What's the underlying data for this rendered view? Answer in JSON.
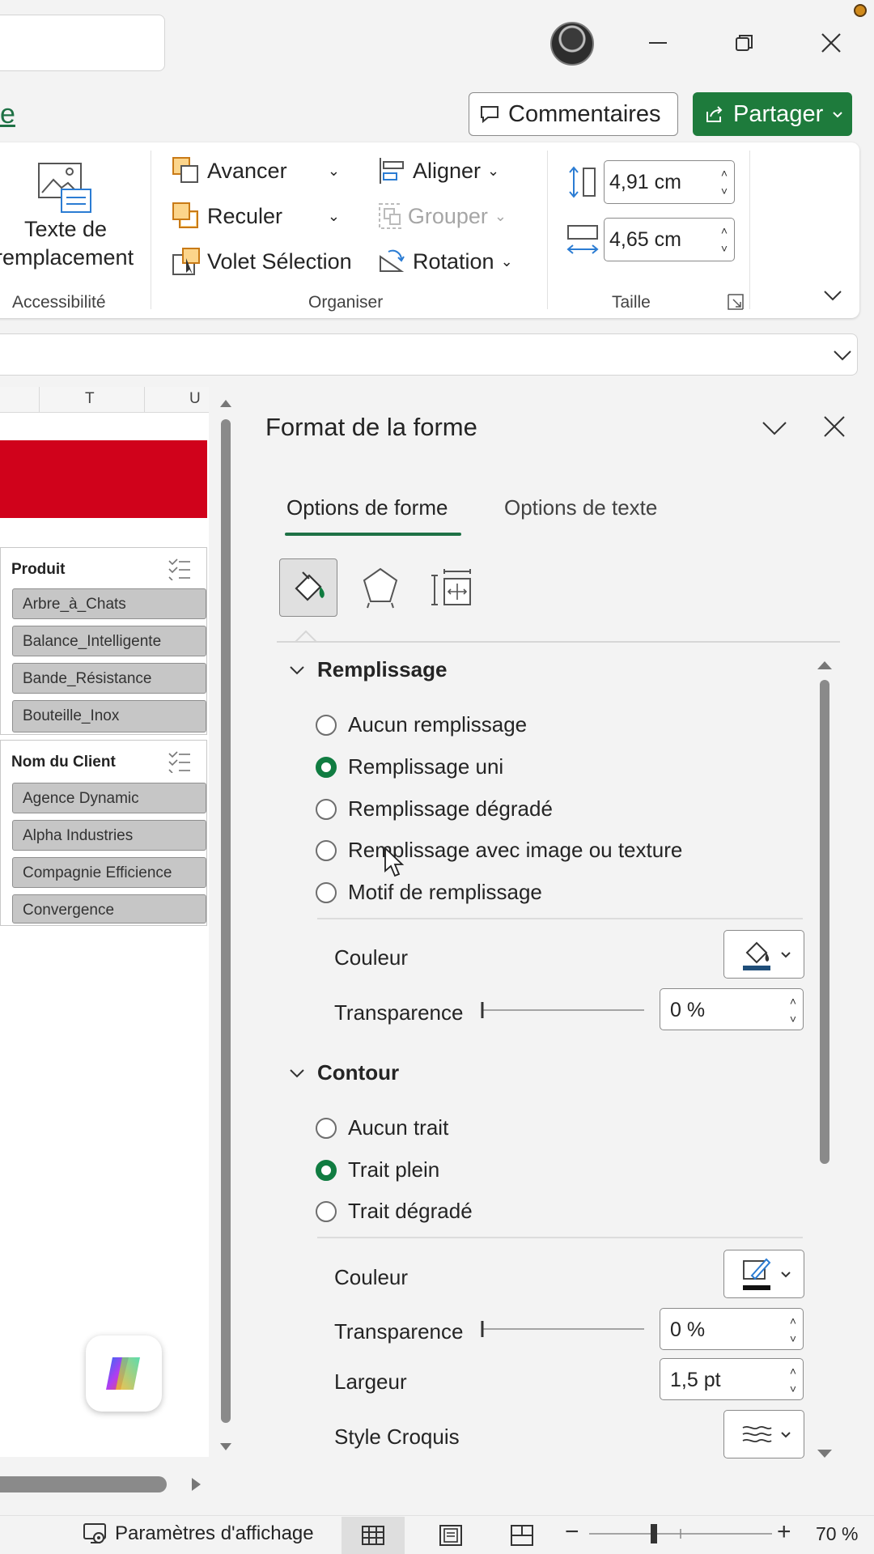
{
  "header": {
    "tab_fragment": "e",
    "comments_label": "Commentaires",
    "share_label": "Partager"
  },
  "ribbon": {
    "accessibility": {
      "button_line1": "Texte de",
      "button_line2": "remplacement",
      "group_label": "Accessibilité"
    },
    "arrange": {
      "bring_forward": "Avancer",
      "send_backward": "Reculer",
      "selection_pane": "Volet Sélection",
      "align": "Aligner",
      "group": "Grouper",
      "rotate": "Rotation",
      "group_label": "Organiser"
    },
    "size": {
      "height": "4,91 cm",
      "width": "4,65 cm",
      "group_label": "Taille"
    }
  },
  "sheet": {
    "columns": [
      "T",
      "U"
    ],
    "banner_color": "#d0021b",
    "slicers": [
      {
        "title": "Produit",
        "items": [
          "Arbre_à_Chats",
          "Balance_Intelligente",
          "Bande_Résistance",
          "Bouteille_Inox"
        ]
      },
      {
        "title": "Nom du Client",
        "items": [
          "Agence Dynamic",
          "Alpha Industries",
          "Compagnie Efficience",
          "Convergence"
        ]
      }
    ]
  },
  "pane": {
    "title": "Format de la forme",
    "tabs": [
      "Options de forme",
      "Options de texte"
    ],
    "fill": {
      "heading": "Remplissage",
      "options": [
        {
          "label": "Aucun remplissage",
          "selected": false
        },
        {
          "label": "Remplissage uni",
          "selected": true
        },
        {
          "label": "Remplissage dégradé",
          "selected": false
        },
        {
          "label": "Remplissage avec image ou texture",
          "selected": false
        },
        {
          "label": "Motif de remplissage",
          "selected": false
        }
      ],
      "color_label": "Couleur",
      "transparency_label": "Transparence",
      "transparency_value": "0 %",
      "transparency_level": 0
    },
    "line": {
      "heading": "Contour",
      "options": [
        {
          "label": "Aucun trait",
          "selected": false
        },
        {
          "label": "Trait plein",
          "selected": true
        },
        {
          "label": "Trait dégradé",
          "selected": false
        }
      ],
      "color_label": "Couleur",
      "transparency_label": "Transparence",
      "transparency_value": "0 %",
      "transparency_level": 0,
      "width_label": "Largeur",
      "width_value": "1,5 pt",
      "sketch_label": "Style Croquis"
    }
  },
  "statusbar": {
    "display_settings": "Paramètres d'affichage",
    "zoom": "70 %"
  },
  "colors": {
    "accent_green": "#1e7145",
    "share_green": "#1e7b3c",
    "radio_green": "#107c41"
  }
}
